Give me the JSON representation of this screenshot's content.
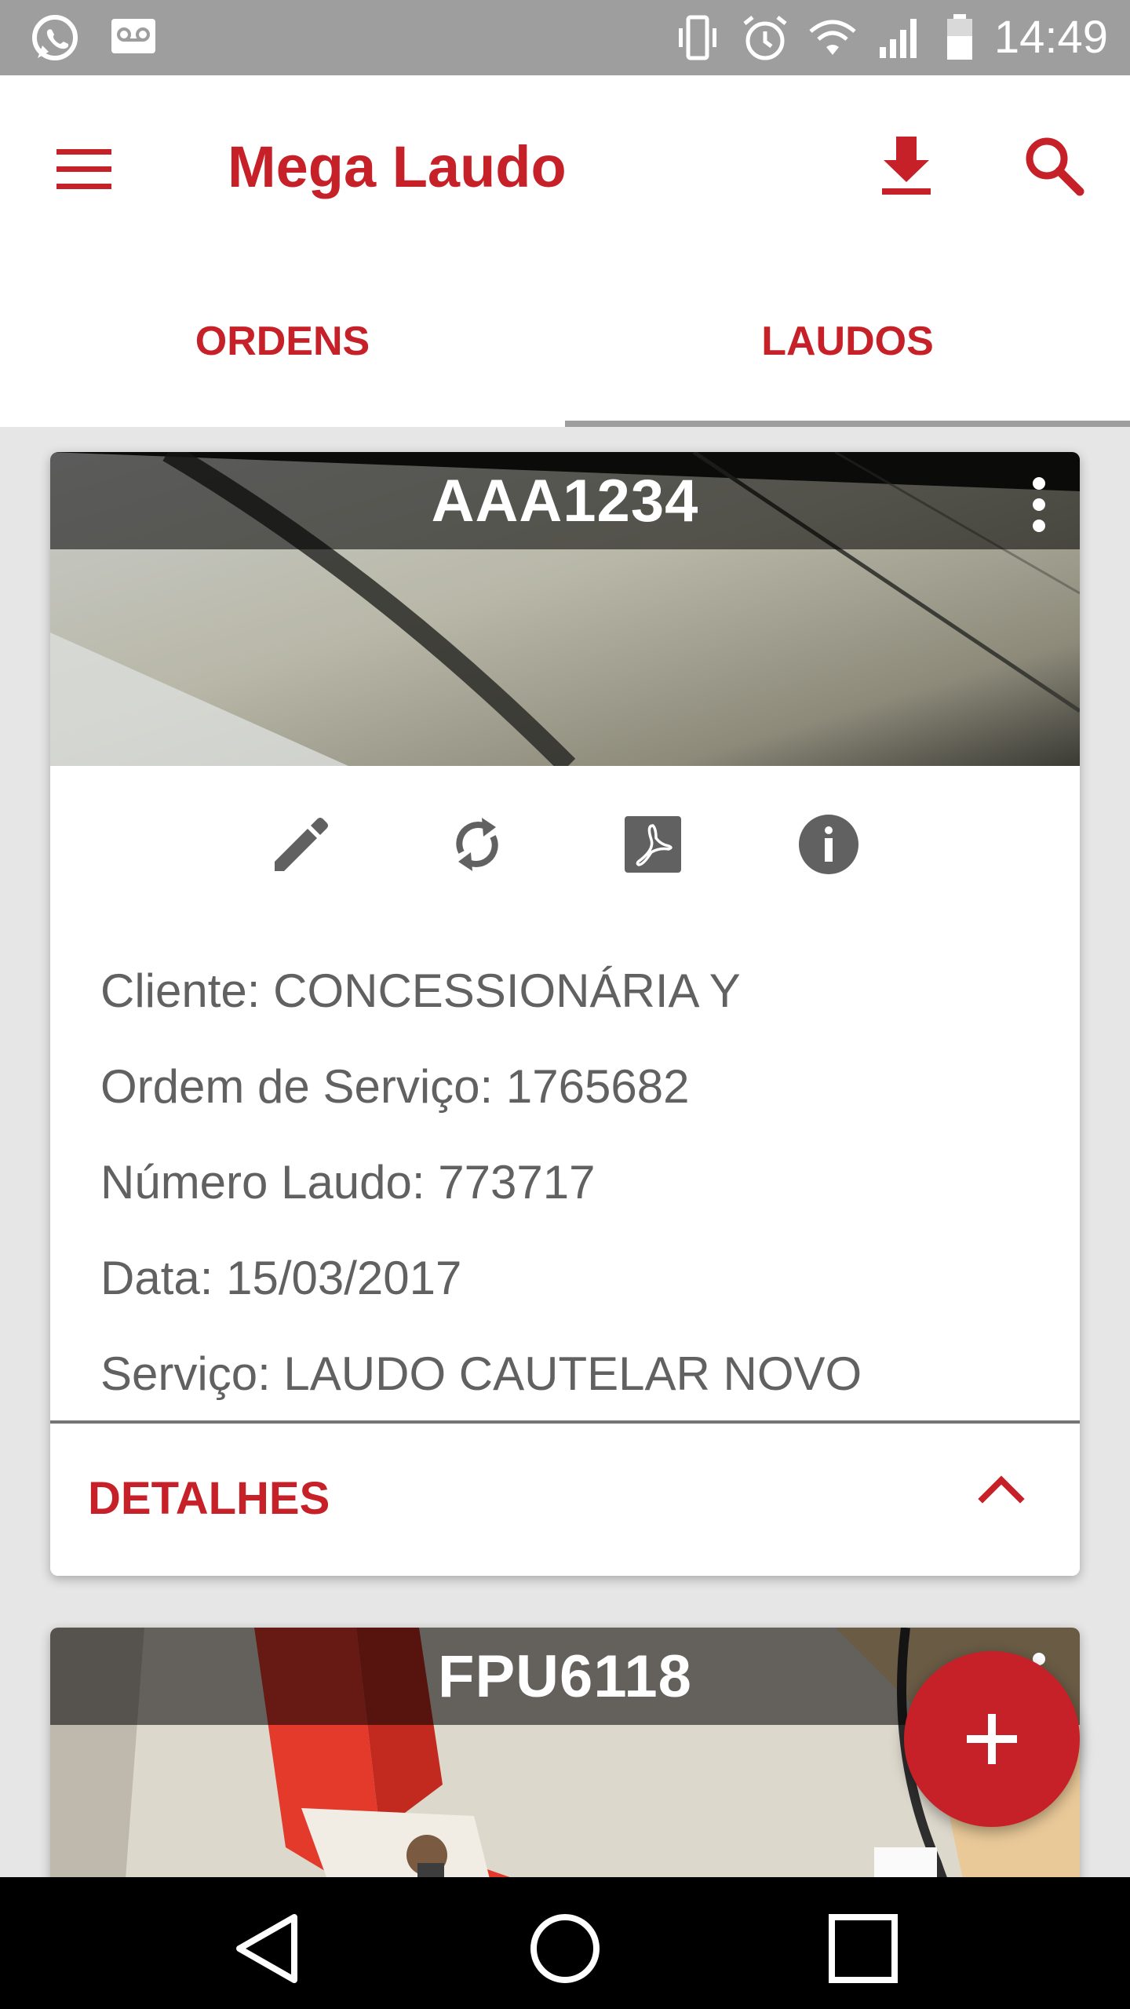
{
  "status_bar": {
    "time": "14:49",
    "left_icons": [
      "whatsapp-icon",
      "voicemail-icon"
    ],
    "right_icons": [
      "vibrate-icon",
      "alarm-icon",
      "wifi-icon",
      "signal-icon",
      "battery-icon"
    ]
  },
  "app_bar": {
    "title": "Mega Laudo",
    "icons": [
      "menu-icon",
      "download-icon",
      "search-icon"
    ]
  },
  "tabs": [
    {
      "label": "ORDENS",
      "selected": false
    },
    {
      "label": "LAUDOS",
      "selected": true
    }
  ],
  "cards": [
    {
      "plate": "AAA1234",
      "actions": [
        "edit-icon",
        "sync-icon",
        "pdf-icon",
        "info-icon"
      ],
      "fields": [
        "Cliente: CONCESSIONÁRIA Y",
        "Ordem de Serviço: 1765682",
        "Número Laudo: 773717",
        "Data: 15/03/2017",
        "Serviço: LAUDO CAUTELAR NOVO"
      ],
      "details_label": "DETALHES",
      "expanded": true
    },
    {
      "plate": "FPU6118"
    }
  ],
  "fab": {
    "icon": "add-icon"
  },
  "nav_bar": {
    "icons": [
      "back-icon",
      "home-icon",
      "recents-icon"
    ]
  },
  "colors": {
    "accent": "#c62128",
    "status_bar": "#9e9e9e",
    "background": "#e6e6e6",
    "field_text": "#616161",
    "icon_gray": "#616161"
  }
}
